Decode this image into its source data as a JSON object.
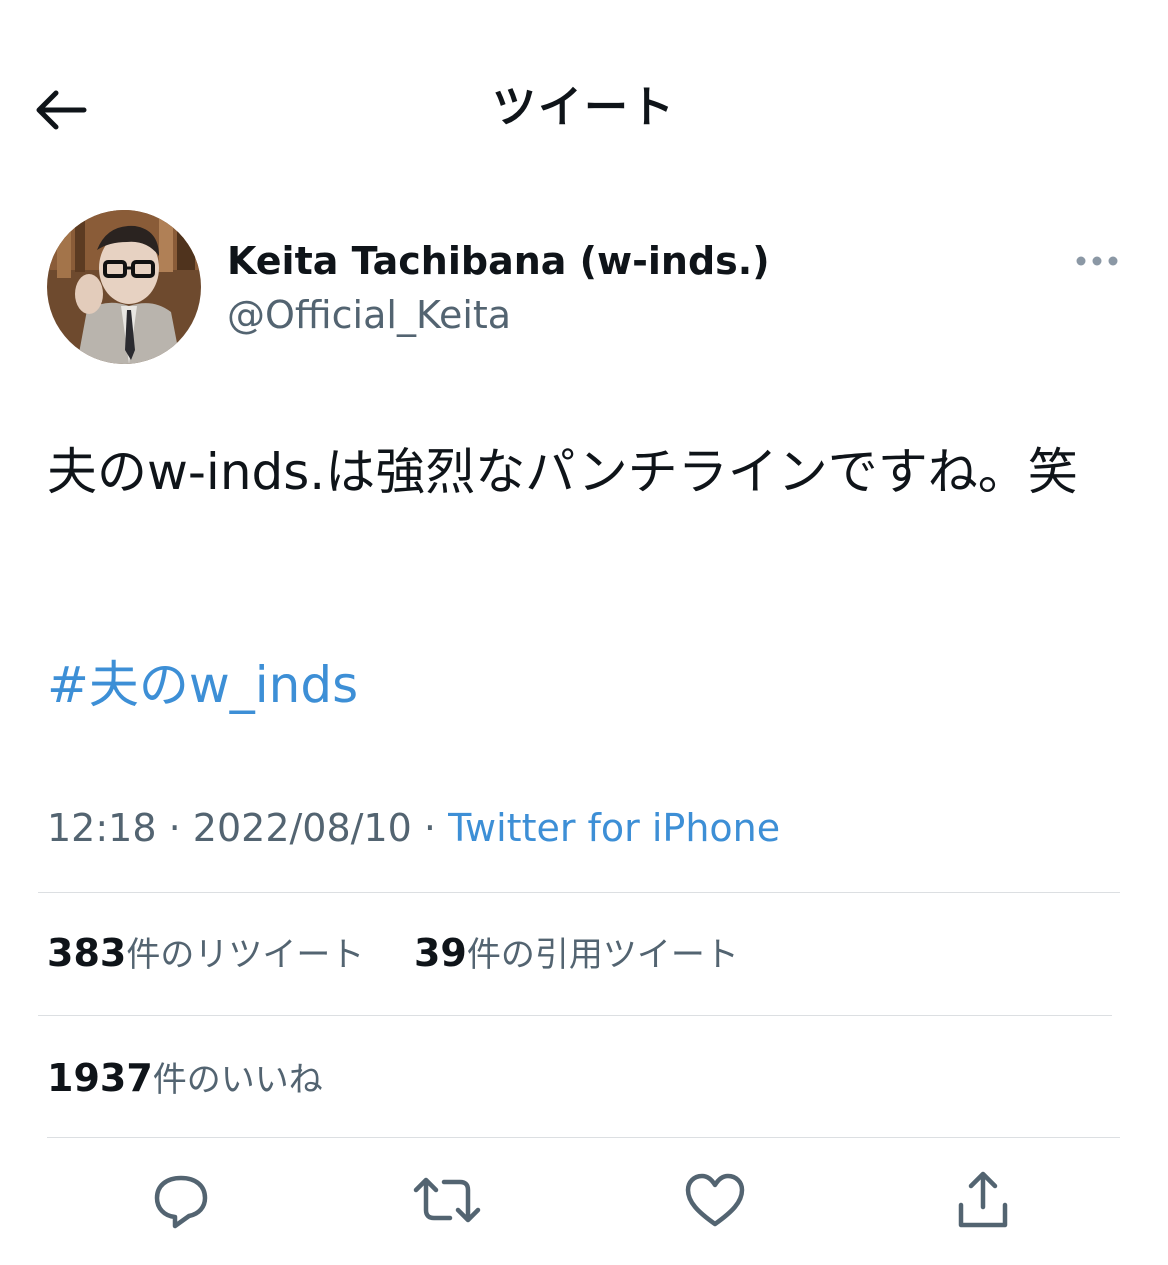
{
  "header": {
    "title": "ツイート",
    "back_icon": "arrow-left-icon"
  },
  "author": {
    "display_name": "Keita Tachibana (w-inds.)",
    "handle": "@Official_Keita",
    "more_icon": "more-horizontal-icon"
  },
  "tweet": {
    "text": "夫のw-inds.は強烈なパンチラインですね。笑",
    "hashtag": "#夫のw_inds"
  },
  "meta": {
    "time": "12:18",
    "date": "2022/08/10",
    "separator": "·",
    "source": "Twitter for iPhone"
  },
  "stats": {
    "retweets_count": "383",
    "retweets_label": "件のリツイート",
    "quotes_count": "39",
    "quotes_label": "件の引用ツイート",
    "likes_count": "1937",
    "likes_label": "件のいいね"
  },
  "actions": {
    "reply_icon": "reply-icon",
    "retweet_icon": "retweet-icon",
    "like_icon": "heart-icon",
    "share_icon": "share-icon"
  },
  "colors": {
    "link": "#3d8fd6",
    "secondary_text": "#536471",
    "divider": "#dcdfe2"
  }
}
